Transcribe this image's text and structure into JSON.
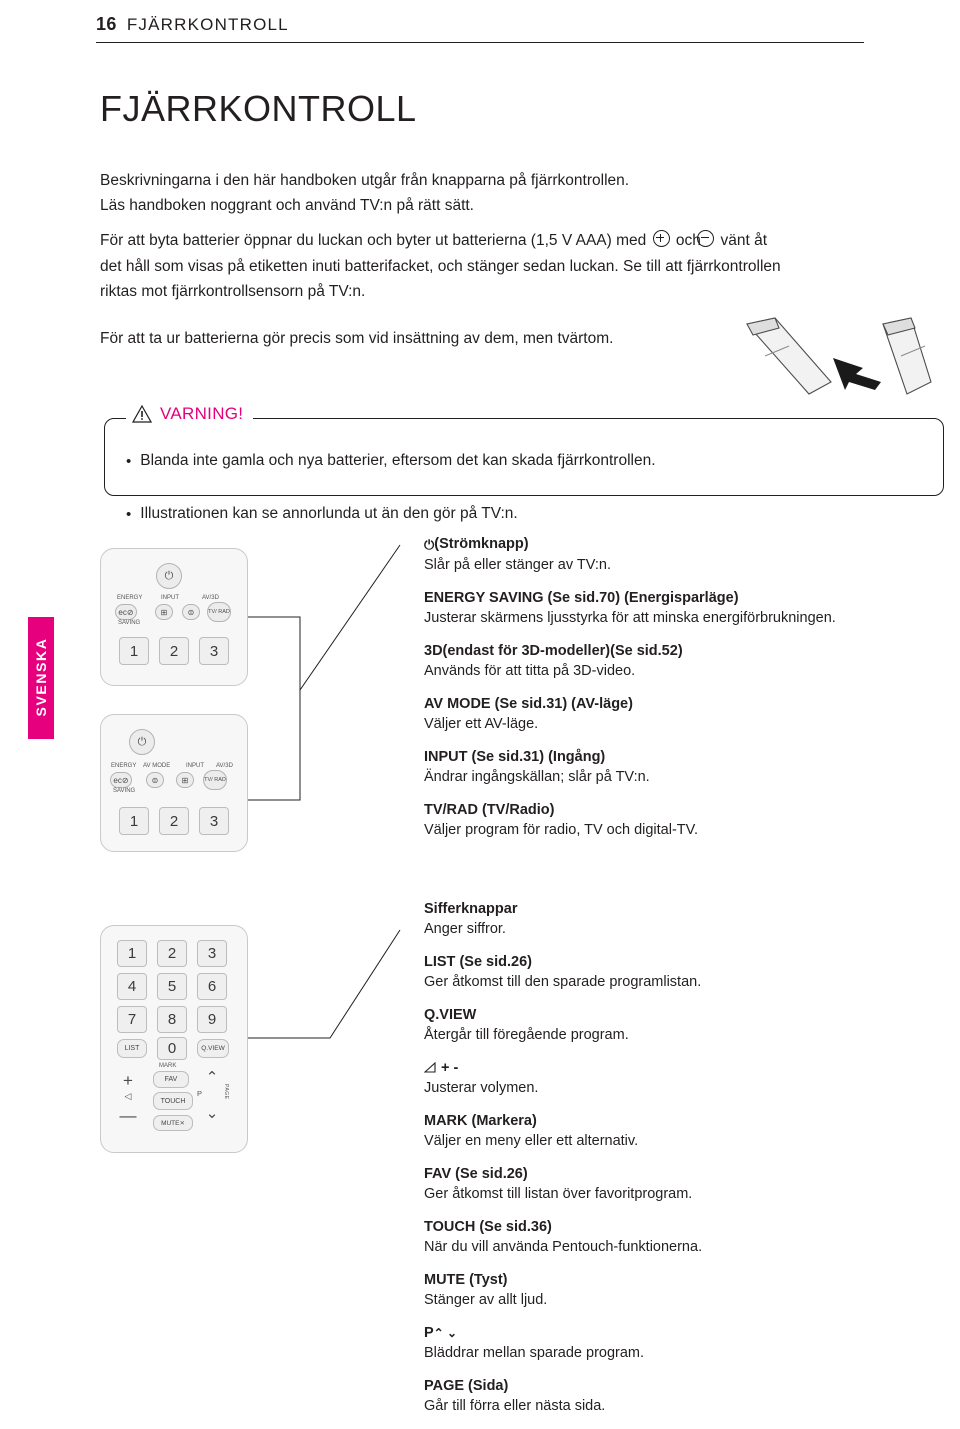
{
  "header": {
    "page_number": "16",
    "section": "FJÄRRKONTROLL"
  },
  "side_tab": {
    "label": "SVENSKA"
  },
  "chapter_title": "FJÄRRKONTROLL",
  "intro": {
    "line1": "Beskrivningarna i den här handboken utgår från knapparna på fjärrkontrollen.",
    "line2": "Läs handboken noggrant och använd TV:n på rätt sätt.",
    "para2_a": "För att byta batterier öppnar du luckan och byter ut batterierna (1,5 V AAA) med",
    "para2_och": "och",
    "para2_b": "vänt åt",
    "para2_c": "det håll som visas på etiketten inuti batterifacket, och stänger sedan luckan. Se till att fjärrkontrollen",
    "para2_d": "riktas mot fjärrkontrollsensorn på TV:n.",
    "para3": "För att ta ur batterierna gör precis som vid insättning av dem, men tvärtom."
  },
  "warning": {
    "label": "VARNING!",
    "bullet": "•",
    "item": "Blanda inte gamla och nya batterier, eftersom det kan skada fjärrkontrollen.",
    "note": "Illustrationen kan se annorlunda ut än den gör på TV:n."
  },
  "remote_top": {
    "power_label": "ENERGY",
    "saving_label": "SAVING",
    "input_label": "INPUT",
    "avmode_label": "AV/3D",
    "tvrad_label": "TV/ RAD",
    "keys": [
      "1",
      "2",
      "3"
    ]
  },
  "remote_mid": {
    "energy_label": "ENERGY",
    "avmode_label": "AV MODE",
    "input_label": "INPUT",
    "avrad_label": "AV/3D",
    "saving_label": "SAVING",
    "tvrad_label": "TV/ RAD",
    "keys": [
      "1",
      "2",
      "3"
    ]
  },
  "remote_bot": {
    "keys": [
      "1",
      "2",
      "3",
      "4",
      "5",
      "6",
      "7",
      "8",
      "9"
    ],
    "list_label": "LIST",
    "zero_label": "0",
    "qview_label": "Q.VIEW",
    "mark_label": "MARK",
    "fav_label": "FAV",
    "touch_label": "TOUCH",
    "mute_label": "MUTE",
    "p_label": "P",
    "page_label": "PAGE"
  },
  "descriptions_upper": [
    {
      "title": "(Strömknapp)",
      "title_prefix_icon": "power-icon",
      "body": "Slår på eller stänger av TV:n."
    },
    {
      "title": "ENERGY SAVING (Se sid.70) (Energisparläge)",
      "body": "Justerar skärmens ljusstyrka för att minska energiförbrukningen."
    },
    {
      "title": "3D(endast för 3D-modeller)(Se sid.52)",
      "body": "Används för att titta på 3D-video."
    },
    {
      "title": "AV MODE (Se sid.31) (AV-läge)",
      "body": "Väljer ett AV-läge."
    },
    {
      "title": "INPUT (Se sid.31) (Ingång)",
      "body": "Ändrar ingångskällan; slår på TV:n."
    },
    {
      "title": "TV/RAD (TV/Radio)",
      "body": "Väljer program för radio, TV och digital-TV."
    }
  ],
  "descriptions_lower": [
    {
      "title": "Sifferknappar",
      "body": "Anger siffror."
    },
    {
      "title": "LIST (Se sid.26)",
      "body": "Ger åtkomst till den sparade programlistan."
    },
    {
      "title": "Q.VIEW",
      "body": "Återgår till föregående program."
    },
    {
      "title": "+ -",
      "title_prefix_icon": "volume-icon",
      "body": "Justerar volymen."
    },
    {
      "title": "MARK (Markera)",
      "body": "Väljer en meny eller ett alternativ."
    },
    {
      "title": "FAV (Se sid.26)",
      "body": "Ger åtkomst till listan över favoritprogram."
    },
    {
      "title": "TOUCH (Se sid.36)",
      "body": "När du vill använda Pentouch-funktionerna."
    },
    {
      "title": "MUTE (Tyst)",
      "body": "Stänger av allt ljud."
    },
    {
      "title": "P",
      "title_suffix_icon": "chevron-up-down-icon",
      "body": "Bläddrar mellan sparade program."
    },
    {
      "title": "PAGE (Sida)",
      "body": "Går till förra eller nästa sida."
    }
  ],
  "colors": {
    "accent": "#e6007e",
    "text": "#231f20",
    "rule": "#231f20"
  }
}
